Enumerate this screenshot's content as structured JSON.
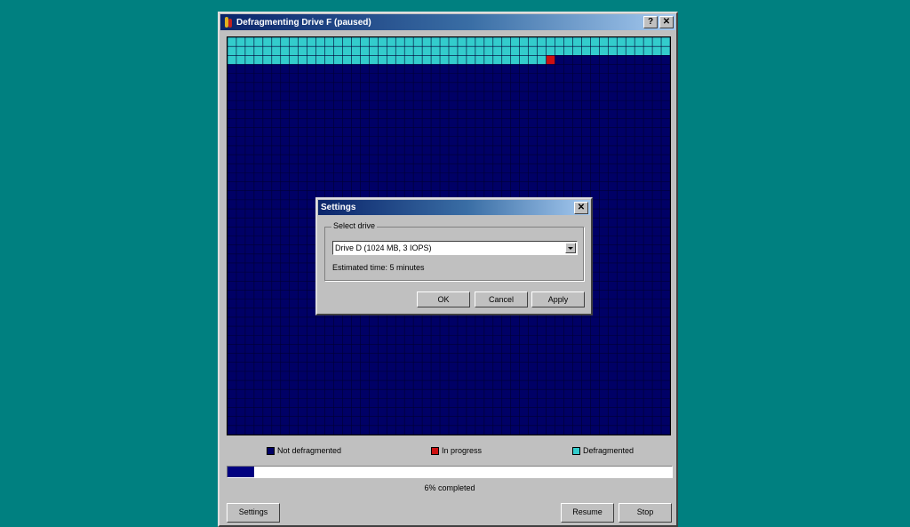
{
  "main_window": {
    "title": "Defragmenting Drive F (paused)",
    "help_button": "?",
    "close_button": "✕",
    "legend": {
      "not_defragmented": "Not defragmented",
      "in_progress": "In progress",
      "defragmented": "Defragmented"
    },
    "progress": {
      "fraction": 0.06,
      "label": "6% completed"
    },
    "colors": {
      "not_defragmented": "#000066",
      "in_progress": "#cc1111",
      "defragmented": "#33cccc",
      "progress_fill": "#000080"
    },
    "buttons": {
      "settings": "Settings",
      "resume": "Resume",
      "stop": "Stop"
    }
  },
  "disk_map": {
    "columns": 50,
    "rows": 44,
    "defragmented_blocks": 136,
    "in_progress_block": 136
  },
  "settings_dialog": {
    "title": "Settings",
    "close_button": "✕",
    "group_label": "Select drive",
    "drive_select_value": "Drive D (1024 MB, 3 IOPS)",
    "estimated_time": "Estimated time: 5 minutes",
    "buttons": {
      "ok": "OK",
      "cancel": "Cancel",
      "apply": "Apply"
    }
  }
}
